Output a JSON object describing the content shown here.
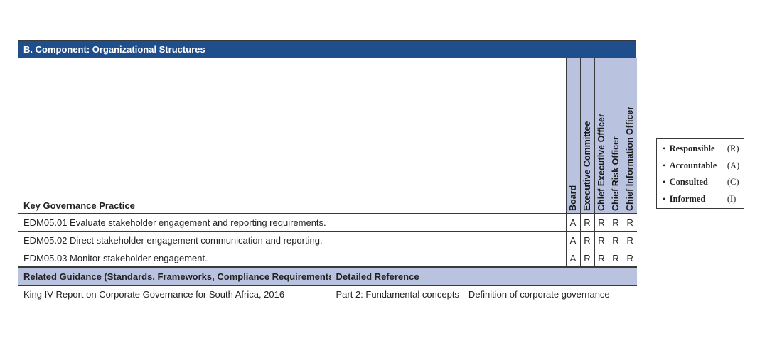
{
  "panel": {
    "title": "B. Component: Organizational Structures",
    "practice_header": "Key Governance Practice",
    "roles": [
      "Board",
      "Executive Committee",
      "Chief Executive Officer",
      "Chief Risk Officer",
      "Chief Information Officer"
    ],
    "practices": [
      {
        "text": "EDM05.01 Evaluate stakeholder engagement and reporting requirements.",
        "values": [
          "A",
          "R",
          "R",
          "R",
          "R"
        ]
      },
      {
        "text": "EDM05.02 Direct stakeholder engagement communication and reporting.",
        "values": [
          "A",
          "R",
          "R",
          "R",
          "R"
        ]
      },
      {
        "text": "EDM05.03 Monitor stakeholder engagement.",
        "values": [
          "A",
          "R",
          "R",
          "R",
          "R"
        ]
      }
    ],
    "guidance": {
      "col1_header": "Related Guidance (Standards, Frameworks, Compliance Requirements)",
      "col2_header": "Detailed Reference",
      "row": {
        "guidance": "King IV Report on Corporate Governance for South Africa, 2016",
        "reference": "Part 2: Fundamental concepts—Definition of corporate governance"
      }
    }
  },
  "legend": {
    "items": [
      {
        "term": "Responsible",
        "abbr": "(R)"
      },
      {
        "term": "Accountable",
        "abbr": "(A)"
      },
      {
        "term": "Consulted",
        "abbr": "(C)"
      },
      {
        "term": "Informed",
        "abbr": "(I)"
      }
    ]
  },
  "colors": {
    "title_bar": "#1f4e8c",
    "header_fill": "#b9c3e0"
  }
}
